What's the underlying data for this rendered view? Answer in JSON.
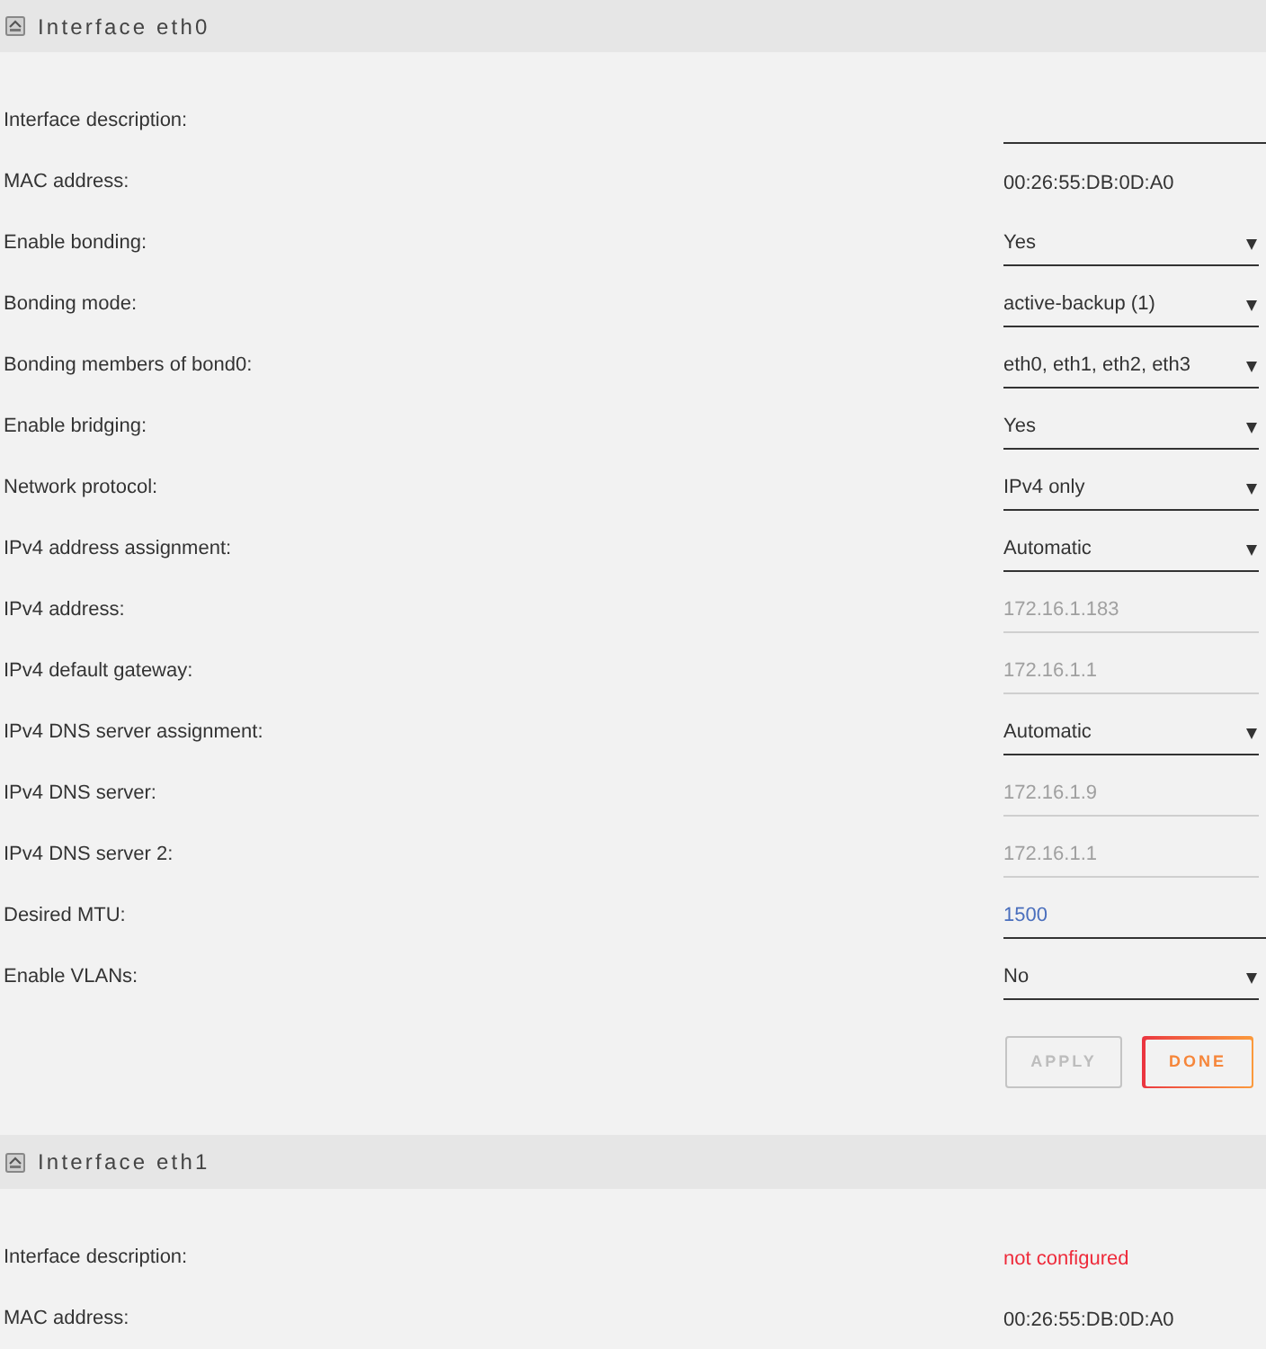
{
  "sections": [
    {
      "title": "Interface eth0",
      "rows": [
        {
          "label": "Interface description:",
          "kind": "input"
        },
        {
          "label": "MAC address:",
          "kind": "text",
          "value": "00:26:55:DB:0D:A0"
        },
        {
          "label": "Enable bonding:",
          "kind": "select",
          "value": "Yes"
        },
        {
          "label": "Bonding mode:",
          "kind": "select",
          "value": "active-backup (1)"
        },
        {
          "label": "Bonding members of bond0:",
          "kind": "select",
          "value": "eth0, eth1, eth2, eth3"
        },
        {
          "label": "Enable bridging:",
          "kind": "select",
          "value": "Yes"
        },
        {
          "label": "Network protocol:",
          "kind": "select",
          "value": "IPv4 only"
        },
        {
          "label": "IPv4 address assignment:",
          "kind": "select",
          "value": "Automatic"
        },
        {
          "label": "IPv4 address:",
          "kind": "readonly",
          "value": "172.16.1.183"
        },
        {
          "label": "IPv4 default gateway:",
          "kind": "readonly",
          "value": "172.16.1.1"
        },
        {
          "label": "IPv4 DNS server assignment:",
          "kind": "select",
          "value": "Automatic"
        },
        {
          "label": "IPv4 DNS server:",
          "kind": "readonly",
          "value": "172.16.1.9"
        },
        {
          "label": "IPv4 DNS server 2:",
          "kind": "readonly",
          "value": "172.16.1.1"
        },
        {
          "label": "Desired MTU:",
          "kind": "input",
          "value": "1500"
        },
        {
          "label": "Enable VLANs:",
          "kind": "select",
          "value": "No"
        }
      ],
      "buttons": [
        {
          "label": "APPLY",
          "kind": "secondary",
          "disabled": true
        },
        {
          "label": "DONE",
          "kind": "primary",
          "disabled": false
        }
      ]
    },
    {
      "title": "Interface eth1",
      "rows": [
        {
          "label": "Interface description:",
          "kind": "warning",
          "value": "not configured"
        },
        {
          "label": "MAC address:",
          "kind": "text",
          "value": "00:26:55:DB:0D:A0"
        }
      ]
    }
  ]
}
